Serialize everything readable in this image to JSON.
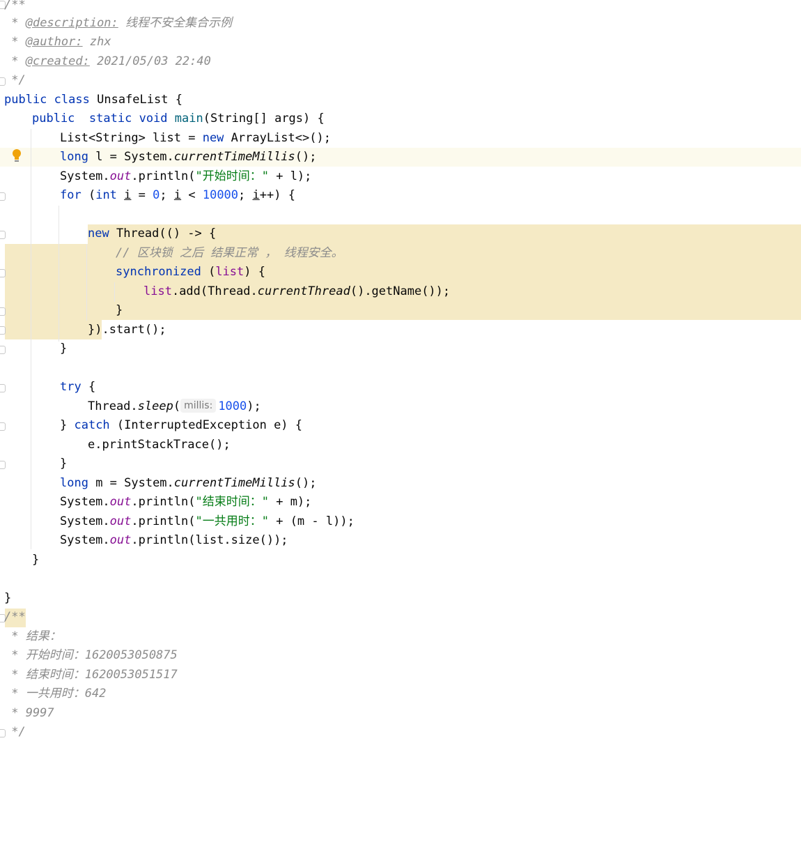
{
  "code": {
    "doc_comment": {
      "open": "/**",
      "description_tag": "@description:",
      "description_text": " 线程不安全集合示例",
      "author_tag": "@author:",
      "author_text": " zhx",
      "created_tag": "@created:",
      "created_text": " 2021/05/03 22:40",
      "close": " */"
    },
    "class_decl": {
      "keyword_public": "public",
      "keyword_class": "class",
      "class_name": "UnsafeList",
      "brace": "{"
    },
    "main_decl": {
      "keyword_public": "public",
      "keyword_static": "static",
      "keyword_void": "void",
      "method_name": "main",
      "params": "(String[] args) {"
    },
    "line_list": {
      "type": "List<String> list = ",
      "keyword_new": "new",
      "init": " ArrayList<>();"
    },
    "line_start_time": {
      "keyword_long": "long",
      "decl": " l = System.",
      "method": "currentTimeMillis",
      "tail": "();"
    },
    "line_print_start": {
      "prefix": "System.",
      "field": "out",
      "call": ".println(",
      "string": "\"开始时间：\"",
      "tail": " + l);"
    },
    "line_for": {
      "keyword_for": "for",
      "open": " (",
      "keyword_int": "int",
      "var1": "i",
      "eq": " = ",
      "zero": "0",
      "semi1": "; ",
      "var2": "i",
      "lt": " < ",
      "limit": "10000",
      "semi2": "; ",
      "var3": "i",
      "tail": "++) {"
    },
    "line_new_thread": {
      "keyword_new": "new",
      "tail": " Thread(() -> {"
    },
    "line_inline_comment": "// 区块锁 之后 结果正常 ， 线程安全。",
    "line_sync": {
      "keyword_sync": "synchronized",
      "open": " (",
      "var": "list",
      "tail": ") {"
    },
    "line_add": {
      "var": "list",
      "call": ".add(Thread.",
      "method": "currentThread",
      "tail": "().getName());"
    },
    "line_close_sync": "}",
    "line_start_call": {
      "brace": "})",
      "tail": ".start();"
    },
    "line_close_for": "}",
    "line_try": {
      "keyword_try": "try",
      "tail": " {"
    },
    "line_sleep": {
      "prefix": "Thread.",
      "method": "sleep",
      "paren": "(",
      "hint": "millis:",
      "value": "1000",
      "tail": ");"
    },
    "line_catch": {
      "brace": "} ",
      "keyword_catch": "catch",
      "tail": " (InterruptedException e) {"
    },
    "line_print_stack": "e.printStackTrace();",
    "line_close_try": "}",
    "line_end_time": {
      "keyword_long": "long",
      "decl": " m = System.",
      "method": "currentTimeMillis",
      "tail": "();"
    },
    "line_print_end": {
      "prefix": "System.",
      "field": "out",
      "call": ".println(",
      "string": "\"结束时间：\"",
      "tail": " + m);"
    },
    "line_print_total": {
      "prefix": "System.",
      "field": "out",
      "call": ".println(",
      "string": "\"一共用时：\"",
      "tail": " + (m - l));"
    },
    "line_print_size": {
      "prefix": "System.",
      "field": "out",
      "tail": ".println(list.size());"
    },
    "line_close_main": "}",
    "line_close_class": "}",
    "result_comment": {
      "open": "/**",
      "line1": " * 结果：",
      "line2": " * 开始时间：1620053050875",
      "line3": " * 结束时间：1620053051517",
      "line4": " * 一共用时：642",
      "line5": " * 9997",
      "close": " */"
    },
    "doc_star": " * "
  },
  "colors": {
    "keyword": "#0033b3",
    "number": "#1750eb",
    "string": "#067d17",
    "field": "#871094",
    "comment": "#8c8c8c",
    "current_line": "#fcfaed",
    "block_highlight": "#f5eac5",
    "bulb": "#f0a30a"
  },
  "icons": {
    "gutter_intention": "lightbulb-icon",
    "gutter_fold": "fold-marker-icon"
  }
}
